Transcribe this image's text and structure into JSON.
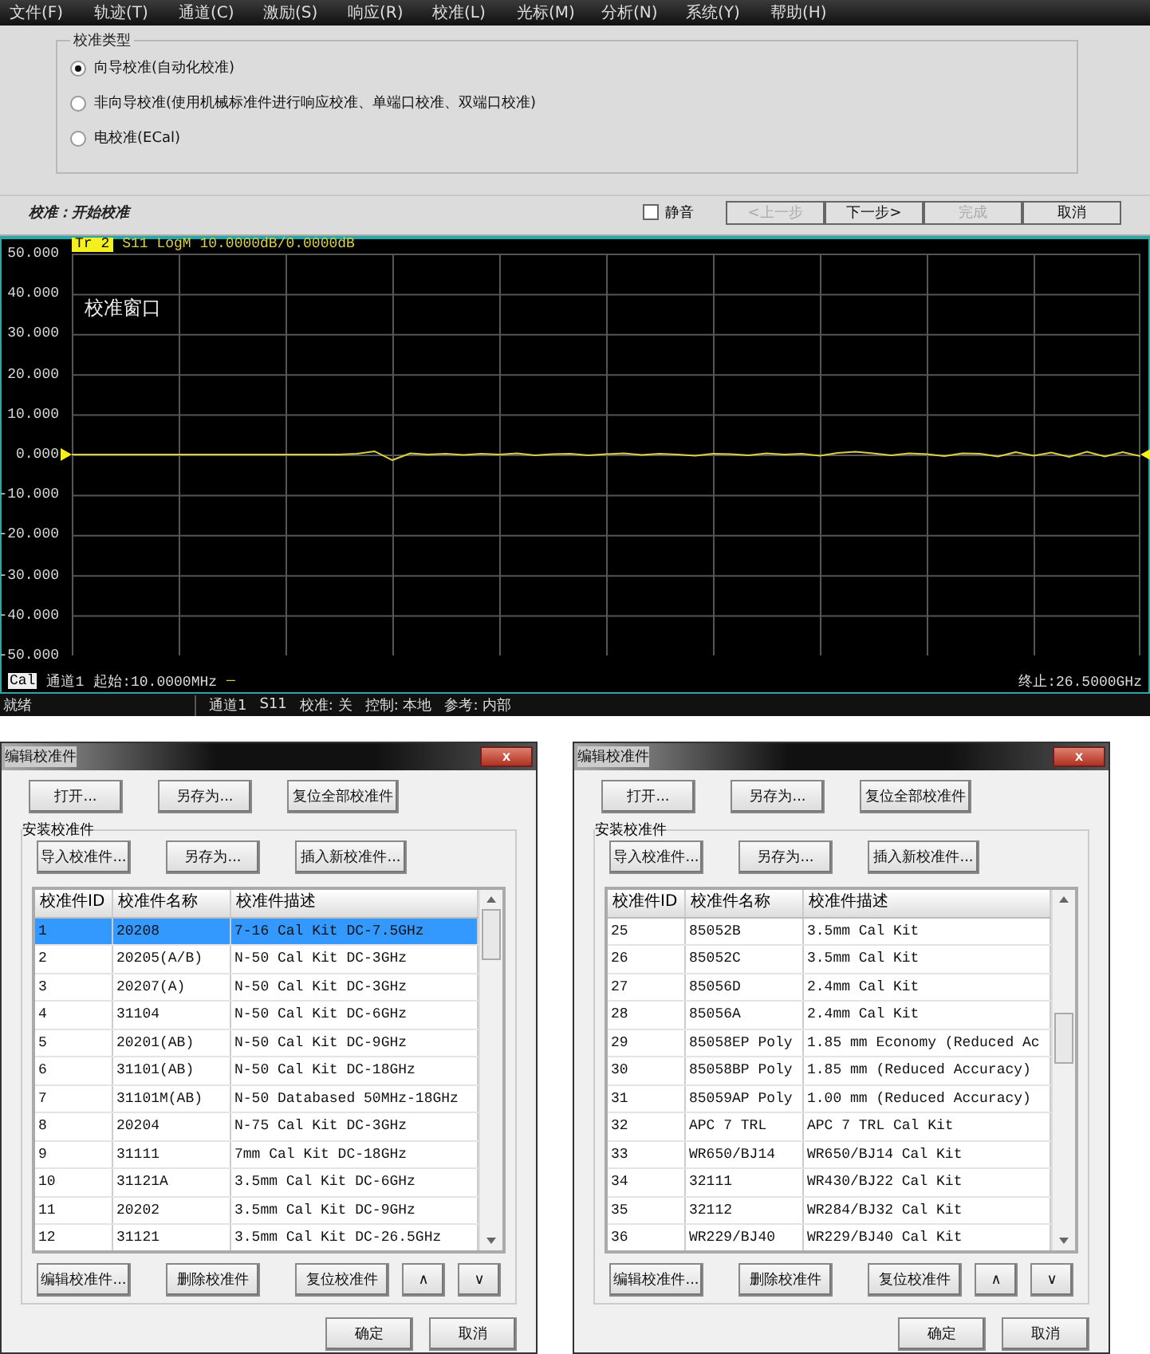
{
  "menu": [
    "文件(F)",
    "轨迹(T)",
    "通道(C)",
    "激励(S)",
    "响应(R)",
    "校准(L)",
    "光标(M)",
    "分析(N)",
    "系统(Y)",
    "帮助(H)"
  ],
  "calibration_panel": {
    "group_title": "校准类型",
    "options": [
      {
        "label": "向导校准(自动化校准)",
        "selected": true
      },
      {
        "label": "非向导校准(使用机械标准件进行响应校准、单端口校准、双端口校准)",
        "selected": false
      },
      {
        "label": "电校准(ECal)",
        "selected": false
      }
    ],
    "status": "校准：开始校准",
    "mute": {
      "label": "静音",
      "checked": false
    },
    "buttons": [
      {
        "label": "<上一步",
        "disabled": true
      },
      {
        "label": "下一步>",
        "disabled": false
      },
      {
        "label": "完成",
        "disabled": true
      },
      {
        "label": "取消",
        "disabled": false
      }
    ]
  },
  "chart": {
    "trace_label": "Tr 2",
    "trace_scale": "LogM 10.0000dB/0.0000dB",
    "window_label": "校准窗口",
    "channel_badge": "Cal",
    "channel": "通道1",
    "start": "起始:10.0000MHz",
    "start_mark": "—",
    "stop": "终止:26.5000GHz",
    "chart_data": {
      "type": "line",
      "grid": true,
      "ylim": [
        -50,
        50
      ],
      "yticks": [
        {
          "value": 50,
          "label": "50.000"
        },
        {
          "value": 40,
          "label": "40.000"
        },
        {
          "value": 30,
          "label": "30.000"
        },
        {
          "value": 20,
          "label": "20.000"
        },
        {
          "value": 10,
          "label": "10.000"
        },
        {
          "value": 0,
          "label": "0.000"
        },
        {
          "value": -10,
          "label": "-10.000"
        },
        {
          "value": -20,
          "label": "-20.000"
        },
        {
          "value": -30,
          "label": "-30.000"
        },
        {
          "value": -40,
          "label": "-40.000"
        },
        {
          "value": -50,
          "label": "-50.000"
        }
      ],
      "series": [
        {
          "name": "S11",
          "color": "#d8d040",
          "values": [
            0,
            0,
            0,
            0,
            0,
            0,
            0,
            0,
            0,
            0,
            0,
            0,
            0,
            0,
            0,
            0,
            0.2,
            0.8,
            -1.4,
            0.3,
            0,
            0.2,
            -0.1,
            0.2,
            0,
            0.3,
            -0.2,
            0.1,
            0.2,
            -0.2,
            0.1,
            0.3,
            -0.1,
            0.2,
            0,
            -0.3,
            0.2,
            0.1,
            -0.2,
            0.3,
            0,
            0.2,
            -0.3,
            0.4,
            0.7,
            0.3,
            -0.2,
            0.3,
            0.1,
            -0.4,
            0.3,
            0.2,
            -0.5,
            0.6,
            -0.3,
            0.5,
            -0.6,
            0.7,
            -0.5,
            0.6,
            -0.4
          ]
        }
      ]
    }
  },
  "status_bar": {
    "ready": "就绪",
    "items": [
      "通道1",
      "S11",
      "校准: 关",
      "控制: 本地",
      "参考: 内部"
    ]
  },
  "dialogs": [
    {
      "title": "编辑校准件",
      "close": "x",
      "top_buttons": [
        "打开...",
        "另存为...",
        "复位全部校准件"
      ],
      "group_title": "安装校准件",
      "group_buttons": [
        "导入校准件...",
        "另存为...",
        "插入新校准件..."
      ],
      "columns": [
        "校准件ID",
        "校准件名称",
        "校准件描述"
      ],
      "rows": [
        {
          "cells": [
            "1",
            "20208",
            "7-16 Cal Kit DC-7.5GHz"
          ],
          "selected": true
        },
        {
          "cells": [
            "2",
            "20205(A/B)",
            "N-50 Cal Kit DC-3GHz"
          ],
          "selected": false
        },
        {
          "cells": [
            "3",
            "20207(A)",
            "N-50 Cal Kit DC-3GHz"
          ],
          "selected": false
        },
        {
          "cells": [
            "4",
            "31104",
            "N-50 Cal Kit DC-6GHz"
          ],
          "selected": false
        },
        {
          "cells": [
            "5",
            "20201(AB)",
            "N-50 Cal Kit DC-9GHz"
          ],
          "selected": false
        },
        {
          "cells": [
            "6",
            "31101(AB)",
            "N-50 Cal Kit DC-18GHz"
          ],
          "selected": false
        },
        {
          "cells": [
            "7",
            "31101M(AB)",
            "N-50 Databased 50MHz-18GHz"
          ],
          "selected": false
        },
        {
          "cells": [
            "8",
            "20204",
            "N-75 Cal Kit DC-3GHz"
          ],
          "selected": false
        },
        {
          "cells": [
            "9",
            "31111",
            "7mm Cal Kit DC-18GHz"
          ],
          "selected": false
        },
        {
          "cells": [
            "10",
            "31121A",
            "3.5mm Cal Kit DC-6GHz"
          ],
          "selected": false
        },
        {
          "cells": [
            "11",
            "20202",
            "3.5mm Cal Kit DC-9GHz"
          ],
          "selected": false
        },
        {
          "cells": [
            "12",
            "31121",
            "3.5mm Cal Kit DC-26.5GHz"
          ],
          "selected": false
        }
      ],
      "bottom_buttons": [
        "编辑校准件...",
        "删除校准件",
        "复位校准件",
        "∧",
        "∨"
      ],
      "ok": "确定",
      "cancel": "取消"
    },
    {
      "title": "编辑校准件",
      "close": "x",
      "top_buttons": [
        "打开...",
        "另存为...",
        "复位全部校准件"
      ],
      "group_title": "安装校准件",
      "group_buttons": [
        "导入校准件...",
        "另存为...",
        "插入新校准件..."
      ],
      "columns": [
        "校准件ID",
        "校准件名称",
        "校准件描述"
      ],
      "rows": [
        {
          "cells": [
            "25",
            "85052B",
            "3.5mm Cal Kit"
          ],
          "selected": false
        },
        {
          "cells": [
            "26",
            "85052C",
            "3.5mm Cal Kit"
          ],
          "selected": false
        },
        {
          "cells": [
            "27",
            "85056D",
            "2.4mm Cal Kit"
          ],
          "selected": false
        },
        {
          "cells": [
            "28",
            "85056A",
            "2.4mm Cal Kit"
          ],
          "selected": false
        },
        {
          "cells": [
            "29",
            "85058EP Poly",
            "1.85 mm Economy (Reduced Ac"
          ],
          "selected": false
        },
        {
          "cells": [
            "30",
            "85058BP Poly",
            "1.85 mm (Reduced Accuracy)"
          ],
          "selected": false
        },
        {
          "cells": [
            "31",
            "85059AP Poly",
            "1.00 mm (Reduced Accuracy)"
          ],
          "selected": false
        },
        {
          "cells": [
            "32",
            "APC 7 TRL",
            "APC 7 TRL Cal Kit"
          ],
          "selected": false
        },
        {
          "cells": [
            "33",
            "WR650/BJ14",
            "WR650/BJ14 Cal Kit"
          ],
          "selected": false
        },
        {
          "cells": [
            "34",
            "32111",
            "WR430/BJ22 Cal Kit"
          ],
          "selected": false
        },
        {
          "cells": [
            "35",
            "32112",
            "WR284/BJ32 Cal Kit"
          ],
          "selected": false
        },
        {
          "cells": [
            "36",
            "WR229/BJ40",
            "WR229/BJ40 Cal Kit"
          ],
          "selected": false
        }
      ],
      "bottom_buttons": [
        "编辑校准件...",
        "删除校准件",
        "复位校准件",
        "∧",
        "∨"
      ],
      "ok": "确定",
      "cancel": "取消"
    }
  ]
}
